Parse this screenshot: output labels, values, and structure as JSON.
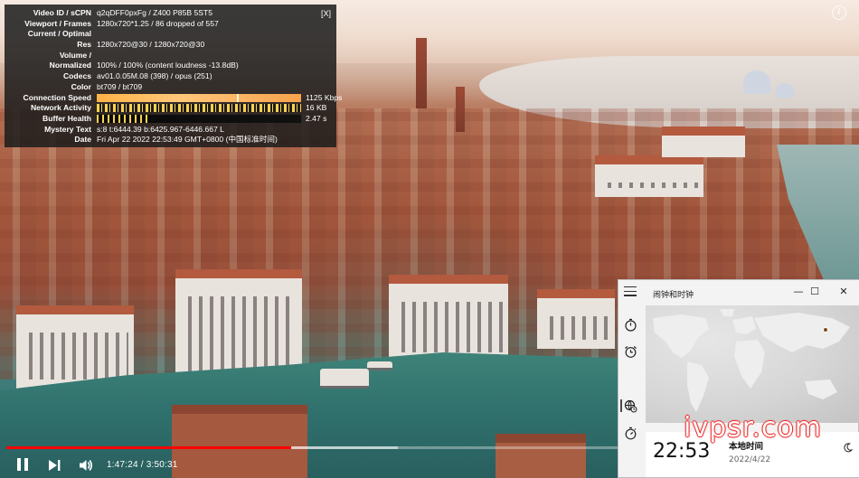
{
  "stats": {
    "rows": [
      {
        "label": "Video ID / sCPN",
        "value": "q2qDFF0pxFg  /  Z400  P85B  5ST5"
      },
      {
        "label": "Viewport / Frames",
        "value": "1280x720*1.25 / 86 dropped of 557"
      },
      {
        "label": "Current / Optimal",
        "value": ""
      },
      {
        "label": "Res",
        "value": "1280x720@30 / 1280x720@30"
      },
      {
        "label": "Volume /",
        "value": ""
      },
      {
        "label": "Normalized",
        "value": "100% / 100% (content loudness -13.8dB)"
      },
      {
        "label": "Codecs",
        "value": "av01.0.05M.08 (398) / opus (251)"
      },
      {
        "label": "Color",
        "value": "bt709 / bt709"
      },
      {
        "label": "Connection Speed",
        "value": "",
        "bar": "speed",
        "right": "1125 Kbps"
      },
      {
        "label": "Network Activity",
        "value": "",
        "bar": "net",
        "right": "16 KB"
      },
      {
        "label": "Buffer Health",
        "value": "",
        "bar": "buf",
        "right": "2.47 s"
      },
      {
        "label": "Mystery Text",
        "value": "s:8 t:6444.39 b:6425.967-6446.667 L"
      },
      {
        "label": "Date",
        "value": "Fri Apr 22 2022 22:53:49 GMT+0800 (中国标准时间)"
      }
    ],
    "close_label": "[X]"
  },
  "player": {
    "info_label": "i",
    "time_display": "1:47:24 / 3:50:31",
    "progress_fraction": 0.4658,
    "buffer_fraction": 0.64
  },
  "clock_app": {
    "title": "闹钟和时钟",
    "minimize": "—",
    "maximize": "☐",
    "close": "✕",
    "time": "22:53",
    "city": "本地时间",
    "date": "2022/4/22"
  },
  "watermark": "ivpsr.com"
}
